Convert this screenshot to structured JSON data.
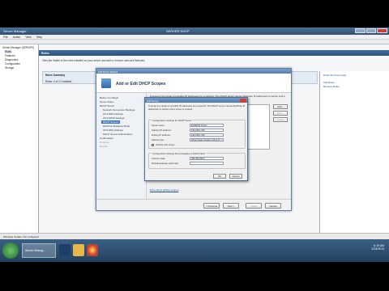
{
  "window": {
    "title": "Server Manager",
    "center_title": "SERVER DHCP"
  },
  "menubar": [
    "File",
    "Action",
    "View",
    "Help"
  ],
  "tree": {
    "items": [
      "Server Manager (SERVER)",
      "Roles",
      "Features",
      "Diagnostics",
      "Configuration",
      "Storage"
    ]
  },
  "main": {
    "header": "Roles",
    "description": "View the health of the roles installed on your server and add or remove roles and features.",
    "summary_title": "Roles Summary",
    "summary_text": "Roles: 0 of 17 installed",
    "summary_help": "Roles Summary Help"
  },
  "actions": {
    "items": [
      "Add Roles",
      "Remove Roles"
    ]
  },
  "wizard": {
    "title": "Add Roles Wizard",
    "heading": "Add or Edit DHCP Scopes",
    "steps": [
      {
        "label": "Before You Begin",
        "state": "normal"
      },
      {
        "label": "Server Roles",
        "state": "normal"
      },
      {
        "label": "DHCP Server",
        "state": "normal"
      },
      {
        "label": "Network Connection Bindings",
        "state": "sub"
      },
      {
        "label": "IPv4 DNS Settings",
        "state": "sub"
      },
      {
        "label": "IPv4 WINS Settings",
        "state": "sub"
      },
      {
        "label": "DHCP Scopes",
        "state": "active"
      },
      {
        "label": "DHCPv6 Stateless Mode",
        "state": "sub"
      },
      {
        "label": "IPv6 DNS Settings",
        "state": "sub"
      },
      {
        "label": "DHCP Server Authorization",
        "state": "sub"
      },
      {
        "label": "Confirmation",
        "state": "normal"
      },
      {
        "label": "Progress",
        "state": "dim"
      },
      {
        "label": "Results",
        "state": "dim"
      }
    ],
    "description": "A scope is the range of possible IP addresses for a network. The DHCP server cannot distribute IP addresses to clients until a scope is created.",
    "side_buttons": [
      "Add...",
      "Edit...",
      "Delete"
    ],
    "more_link": "More about adding scopes",
    "buttons": {
      "previous": "< Previous",
      "next": "Next >",
      "install": "Install",
      "cancel": "Cancel"
    }
  },
  "dialog": {
    "title": "Add Scope",
    "description": "A scope is a range of possible IP addresses for a network. The DHCP server cannot distribute IP addresses to clients until a scope is created.",
    "group1_label": "Configuration settings for DHCP Server",
    "fields": [
      {
        "label": "Scope name:",
        "value": "EGSMUS Scope"
      },
      {
        "label": "Starting IP address:",
        "value": "192.168.1.200"
      },
      {
        "label": "Ending IP address:",
        "value": "192.168.1.240"
      },
      {
        "label": "Subnet type:",
        "value": "Wired (lease duration will be 8 days)"
      }
    ],
    "activate_label": "Activate this scope",
    "group2_label": "Configuration settings that propagate to DHCP client",
    "fields2": [
      {
        "label": "Subnet mask:",
        "value": "255.255.255.0"
      },
      {
        "label": "Default gateway (optional):",
        "value": ""
      }
    ],
    "ok": "OK",
    "cancel": "Cancel"
  },
  "statusbar": {
    "text": "Windows Update: Not configured"
  },
  "taskbar": {
    "app_label": "Server Manag...",
    "time": "6:19 AM",
    "date": "2/23/2013"
  },
  "colors": {
    "title_blue": "#2e4f73",
    "selected_step": "#3b78c8",
    "close_red": "#c7423a"
  }
}
